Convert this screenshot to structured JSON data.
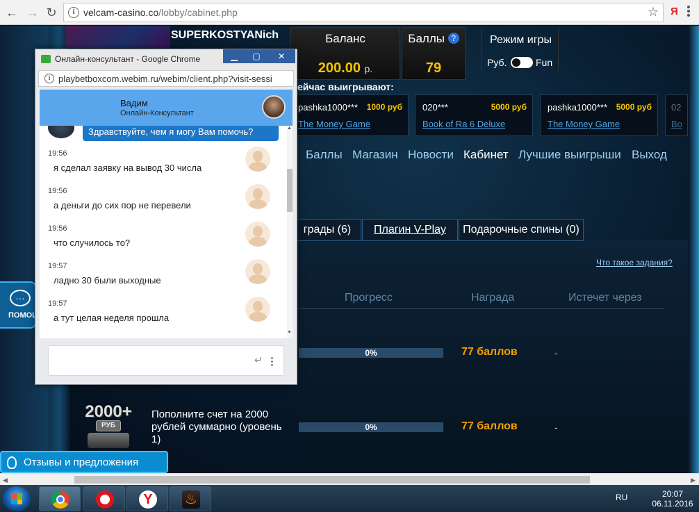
{
  "browser": {
    "url_domain": "velcam-casino.co",
    "url_path": "/lobby/cabinet.php",
    "ext_label": "Я"
  },
  "site": {
    "username": "SUPERKOSTYANich",
    "balance": {
      "label": "Баланс",
      "value": "200.00",
      "unit": "р."
    },
    "points": {
      "label": "Баллы",
      "help": "?",
      "value": "79"
    },
    "mode": {
      "label": "Режим игры",
      "left": "Руб.",
      "right": "Fun"
    },
    "winners_title": "ейчас выигрывают:",
    "winners": [
      {
        "player": "pashka1000***",
        "amount": "1000 руб",
        "game": "The Money Game"
      },
      {
        "player": "020***",
        "amount": "5000 руб",
        "game": "Book of Ra 6 Deluxe"
      },
      {
        "player": "pashka1000***",
        "amount": "5000 руб",
        "game": "The Money Game"
      },
      {
        "player": "02",
        "amount": "",
        "game": "Bo"
      }
    ],
    "nav": [
      "Баллы",
      "Магазин",
      "Новости",
      "Кабинет",
      "Лучшие выигрыши",
      "Выход"
    ],
    "tabs": [
      "грады (6)",
      "Плагин V-Play",
      "Подарочные спины (0)"
    ],
    "task_link": "Что такое задания?",
    "columns": {
      "progress": "Прогресс",
      "reward": "Награда",
      "expires": "Истечет через"
    },
    "tasks": [
      {
        "title": "",
        "progress": "0%",
        "reward": "77 баллов",
        "expires": "-"
      },
      {
        "title": "Пополните счет на 2000 рублей суммарно (уровень 1)",
        "progress": "0%",
        "reward": "77 баллов",
        "expires": "-"
      }
    ],
    "badge": {
      "number": "2000+",
      "currency": "РУБ"
    },
    "help_label": "ПОМОЩ",
    "feedback_label": "Отзывы и предложения"
  },
  "popup": {
    "title": "Онлайн-консультант - Google Chrome",
    "url": "playbetboxcom.webim.ru/webim/client.php?visit-sessi",
    "operator_name": "Вадим",
    "operator_role": "Онлайн-Консультант",
    "greeting": "Здравствуйте, чем я могу Вам помочь?",
    "messages": [
      {
        "time": "19:56",
        "text": "я сделал заявку на вывод 30 числа"
      },
      {
        "time": "19:56",
        "text": "а деньги до сих пор не перевели"
      },
      {
        "time": "19:56",
        "text": "что случилось то?"
      },
      {
        "time": "19:57",
        "text": "ладно 30 были выходные"
      },
      {
        "time": "19:57",
        "text": "а тут целая неделя прошла"
      }
    ],
    "input_placeholder": ""
  },
  "taskbar": {
    "lang": "RU",
    "time": "20:07",
    "date": "06.11.2016"
  },
  "icons": {
    "back": "back-arrow-icon",
    "forward": "forward-arrow-icon",
    "reload": "reload-icon",
    "star": "bookmark-star-icon"
  }
}
